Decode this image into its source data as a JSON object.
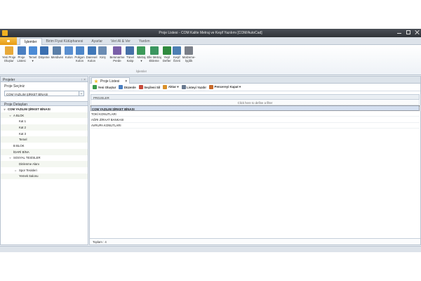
{
  "window": {
    "title": "Proje Listesi - COM Kalite Metraj ve Keşif Yazılımı [COM/AutoCad]"
  },
  "ribbon_tabs": [
    "İşlemler",
    "Birim Fiyat Kütüphanesi",
    "Ayarlar",
    "Veri Al & Ver",
    "Yardım"
  ],
  "active_tab": "İşlemler",
  "ribbon_buttons": [
    {
      "label": "Yeni Proje\nOluştur",
      "icon": "folder-new-icon",
      "color": "#e8a93a"
    },
    {
      "label": "Proje\nListesi",
      "icon": "project-list-icon",
      "color": "#4a7fc1"
    },
    {
      "label": "Temel\n▾",
      "icon": "foundation-icon",
      "color": "#4b8bd6"
    },
    {
      "label": "Döşeme",
      "icon": "slab-icon",
      "color": "#3a6fb0"
    },
    {
      "label": "Merdiven",
      "icon": "stairs-icon",
      "color": "#5b7fa8"
    },
    {
      "label": "Kolon",
      "icon": "column-icon",
      "color": "#5a8fd0"
    },
    {
      "label": "Poligon\nKolon",
      "icon": "polygon-column-icon",
      "color": "#4d86c8"
    },
    {
      "label": "Dairesel\nKolon",
      "icon": "circular-column-icon",
      "color": "#3f77b8"
    },
    {
      "label": "Kiriş",
      "icon": "beam-icon",
      "color": "#6b8cb3"
    },
    {
      "label": "Betonarme\nPerde",
      "icon": "shear-wall-icon",
      "color": "#7a5fa8"
    },
    {
      "label": "Tünel\nKalıp",
      "icon": "tunnel-form-icon",
      "color": "#4670a8"
    },
    {
      "label": "Metraj\n▾",
      "icon": "quantity-icon",
      "color": "#3d9a5a"
    },
    {
      "label": "Elle Metraj\nEkleme",
      "icon": "manual-quantity-icon",
      "color": "#3b9660"
    },
    {
      "label": "Yeşil\nDefter",
      "icon": "green-book-icon",
      "color": "#2f8a3e"
    },
    {
      "label": "Keşif\nÖzeti",
      "icon": "estimate-summary-icon",
      "color": "#4d7fb3"
    },
    {
      "label": "Malzeme-\nİşçilik",
      "icon": "material-labor-icon",
      "color": "#7a7f88"
    }
  ],
  "ribbon_group_name": "İşlemler",
  "left_panel": {
    "title": "Projeler",
    "pin_icons": "↑ ×",
    "select_label": "Proje Seçiniz",
    "selected_project": "COM YAZILIM ŞİRKET BİNASI",
    "tree_header": "Proje Detayları",
    "tree": [
      {
        "label": "COM YAZILIM ŞİRKET BİNASI",
        "level": 0,
        "toggle": "▿",
        "bold": true
      },
      {
        "label": "A BLOK",
        "level": 1,
        "toggle": "▿",
        "bold": false
      },
      {
        "label": "Kat 1",
        "level": 2,
        "toggle": "",
        "bold": false
      },
      {
        "label": "Kat 2",
        "level": 2,
        "toggle": "",
        "bold": false
      },
      {
        "label": "Kat 3",
        "level": 2,
        "toggle": "",
        "bold": false
      },
      {
        "label": "Temel",
        "level": 2,
        "toggle": "",
        "bold": false
      },
      {
        "label": "B BLOK",
        "level": 1,
        "toggle": "",
        "bold": false
      },
      {
        "label": "İDARİ BİNA",
        "level": 1,
        "toggle": "",
        "bold": false
      },
      {
        "label": "SOSYAL TESİSLER",
        "level": 1,
        "toggle": "▿",
        "bold": false
      },
      {
        "label": "Dinlenme Alanı",
        "level": 2,
        "toggle": "",
        "bold": false
      },
      {
        "label": "Spor Tesisleri",
        "level": 2,
        "toggle": "▹",
        "bold": false
      },
      {
        "label": "Yemek Salonu",
        "level": 2,
        "toggle": "",
        "bold": false
      }
    ]
  },
  "main": {
    "doc_tab": "Proje Listesi",
    "doc_tab_close": "×",
    "toolbar": [
      {
        "label": "Yeni Oluştur",
        "icon": "add-icon",
        "color": "#3a9a4a"
      },
      {
        "label": "Düzenle",
        "icon": "edit-icon",
        "color": "#4a7fc1"
      },
      {
        "label": "Seçileni Sil",
        "icon": "delete-icon",
        "color": "#c84a3a"
      },
      {
        "label": "Aktar ▾",
        "icon": "export-icon",
        "color": "#d9902a"
      },
      {
        "label": "Listeyi Yazdır",
        "icon": "print-icon",
        "color": "#6a7a90"
      },
      {
        "label": "Pencereyi Kapat ▾",
        "icon": "close-window-icon",
        "color": "#c86a2a"
      }
    ],
    "column_header": "PROJELER",
    "filter_text": "Click here to define a filter",
    "rows": [
      {
        "name": "COM YAZILIM ŞİRKET BİNASI",
        "selected": true
      },
      {
        "name": "TOKİ KONUTLARI",
        "selected": false
      },
      {
        "name": "AĞRI ZİRAAT BANKASI",
        "selected": false
      },
      {
        "name": "AVRUPA KONUTLARI",
        "selected": false
      }
    ],
    "footer": "Toplam : 4"
  }
}
